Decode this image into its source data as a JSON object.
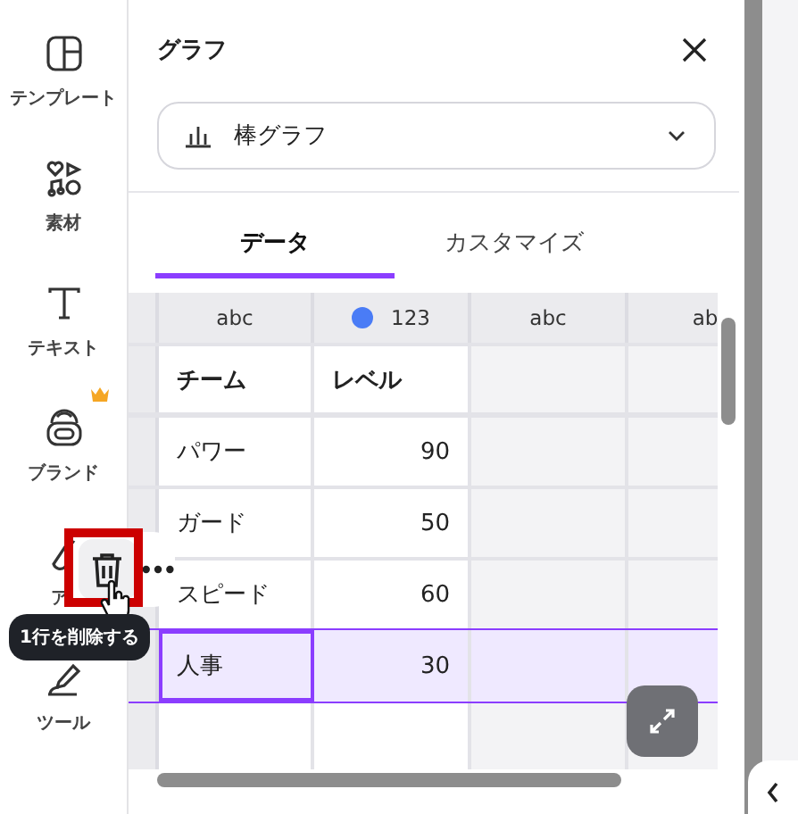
{
  "sidebar": {
    "items": [
      {
        "label": "テンプレート",
        "kind": "template"
      },
      {
        "label": "素材",
        "kind": "elements"
      },
      {
        "label": "テキスト",
        "kind": "text"
      },
      {
        "label": "ブランド",
        "kind": "brand",
        "premium": true
      },
      {
        "label": "ア",
        "kind": "apps"
      },
      {
        "label": "ツール",
        "kind": "tools"
      }
    ]
  },
  "panel": {
    "title": "グラフ",
    "chart_type": {
      "value": "棒グラフ"
    },
    "tabs": [
      {
        "label": "データ",
        "selected": true
      },
      {
        "label": "カスタマイズ",
        "selected": false
      }
    ],
    "table": {
      "column_types": [
        {
          "label": "abc",
          "kind": "text"
        },
        {
          "label": "123",
          "kind": "number"
        },
        {
          "label": "abc",
          "kind": "text"
        },
        {
          "label": "ab",
          "kind": "text"
        }
      ],
      "rows": [
        {
          "kind": "header",
          "selected": false,
          "cells": [
            "チーム",
            "レベル"
          ]
        },
        {
          "kind": "data",
          "selected": false,
          "cells": [
            "パワー",
            "90"
          ]
        },
        {
          "kind": "data",
          "selected": false,
          "cells": [
            "ガード",
            "50"
          ]
        },
        {
          "kind": "data",
          "selected": false,
          "cells": [
            "スピード",
            "60"
          ]
        },
        {
          "kind": "data",
          "selected": true,
          "cells": [
            "人事",
            "30"
          ]
        },
        {
          "kind": "data",
          "selected": false,
          "cells": []
        }
      ]
    }
  },
  "row_menu": {
    "tooltip": "1行を削除する"
  }
}
